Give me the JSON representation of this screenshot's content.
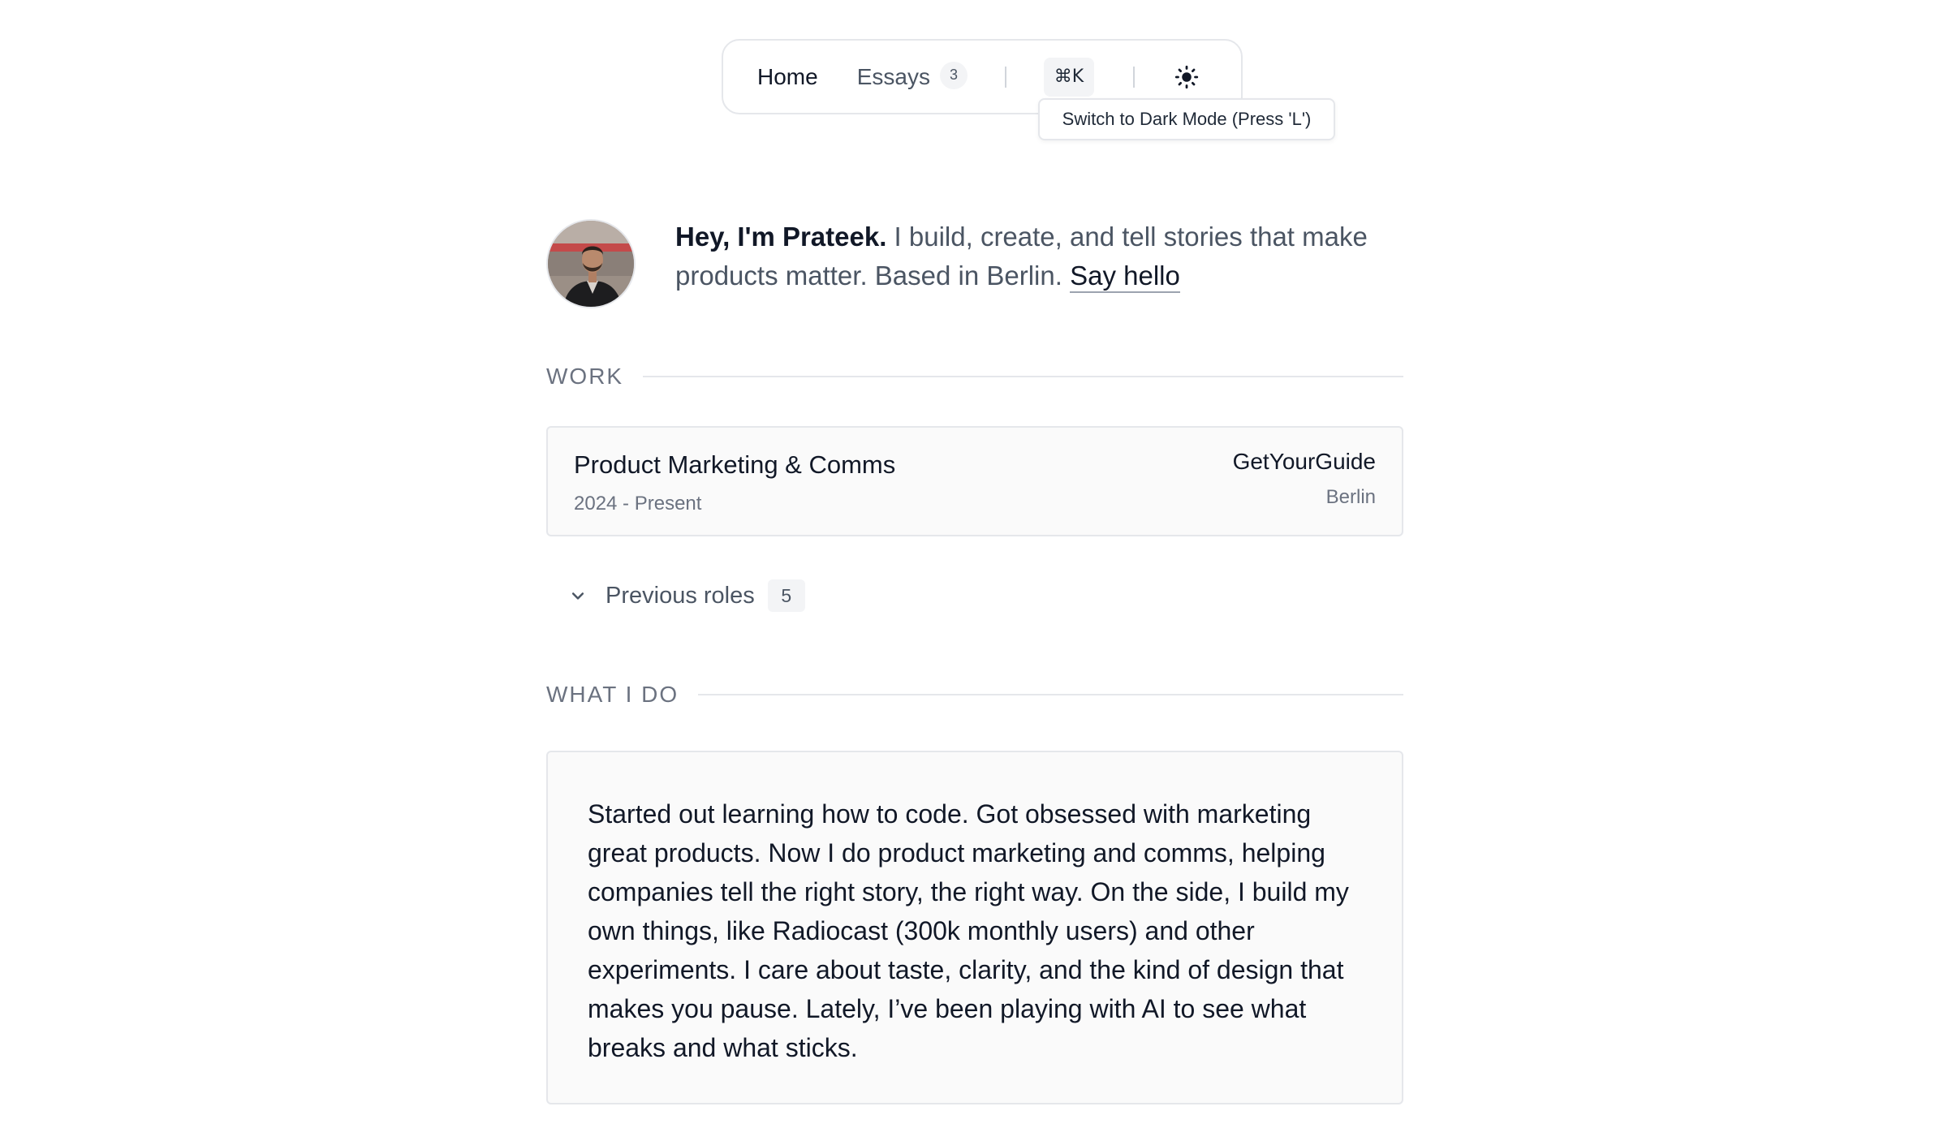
{
  "nav": {
    "home_label": "Home",
    "essays_label": "Essays",
    "essays_count": "3",
    "command_label": "⌘K",
    "theme_icon": "sun-icon",
    "tooltip": "Switch to Dark Mode (Press 'L')"
  },
  "intro": {
    "name": "Hey, I'm Prateek.",
    "tagline": " I build, create, and tell stories that make products matter. Based in Berlin. ",
    "cta": "Say hello"
  },
  "work": {
    "heading": "WORK",
    "current": {
      "role": "Product Marketing & Comms",
      "dates": "2024 - Present",
      "company": "GetYourGuide",
      "location": "Berlin"
    },
    "previous_label": "Previous roles",
    "previous_count": "5"
  },
  "what_i_do": {
    "heading": "WHAT I DO",
    "body": "Started out learning how to code. Got obsessed with marketing great products. Now I do product marketing and comms, helping companies tell the right story, the right way. On the side, I build my own things, like Radiocast (300k monthly users) and other experiments. I care about taste, clarity, and the kind of design that makes you pause. Lately, I’ve been playing with AI to see what breaks and what sticks."
  }
}
